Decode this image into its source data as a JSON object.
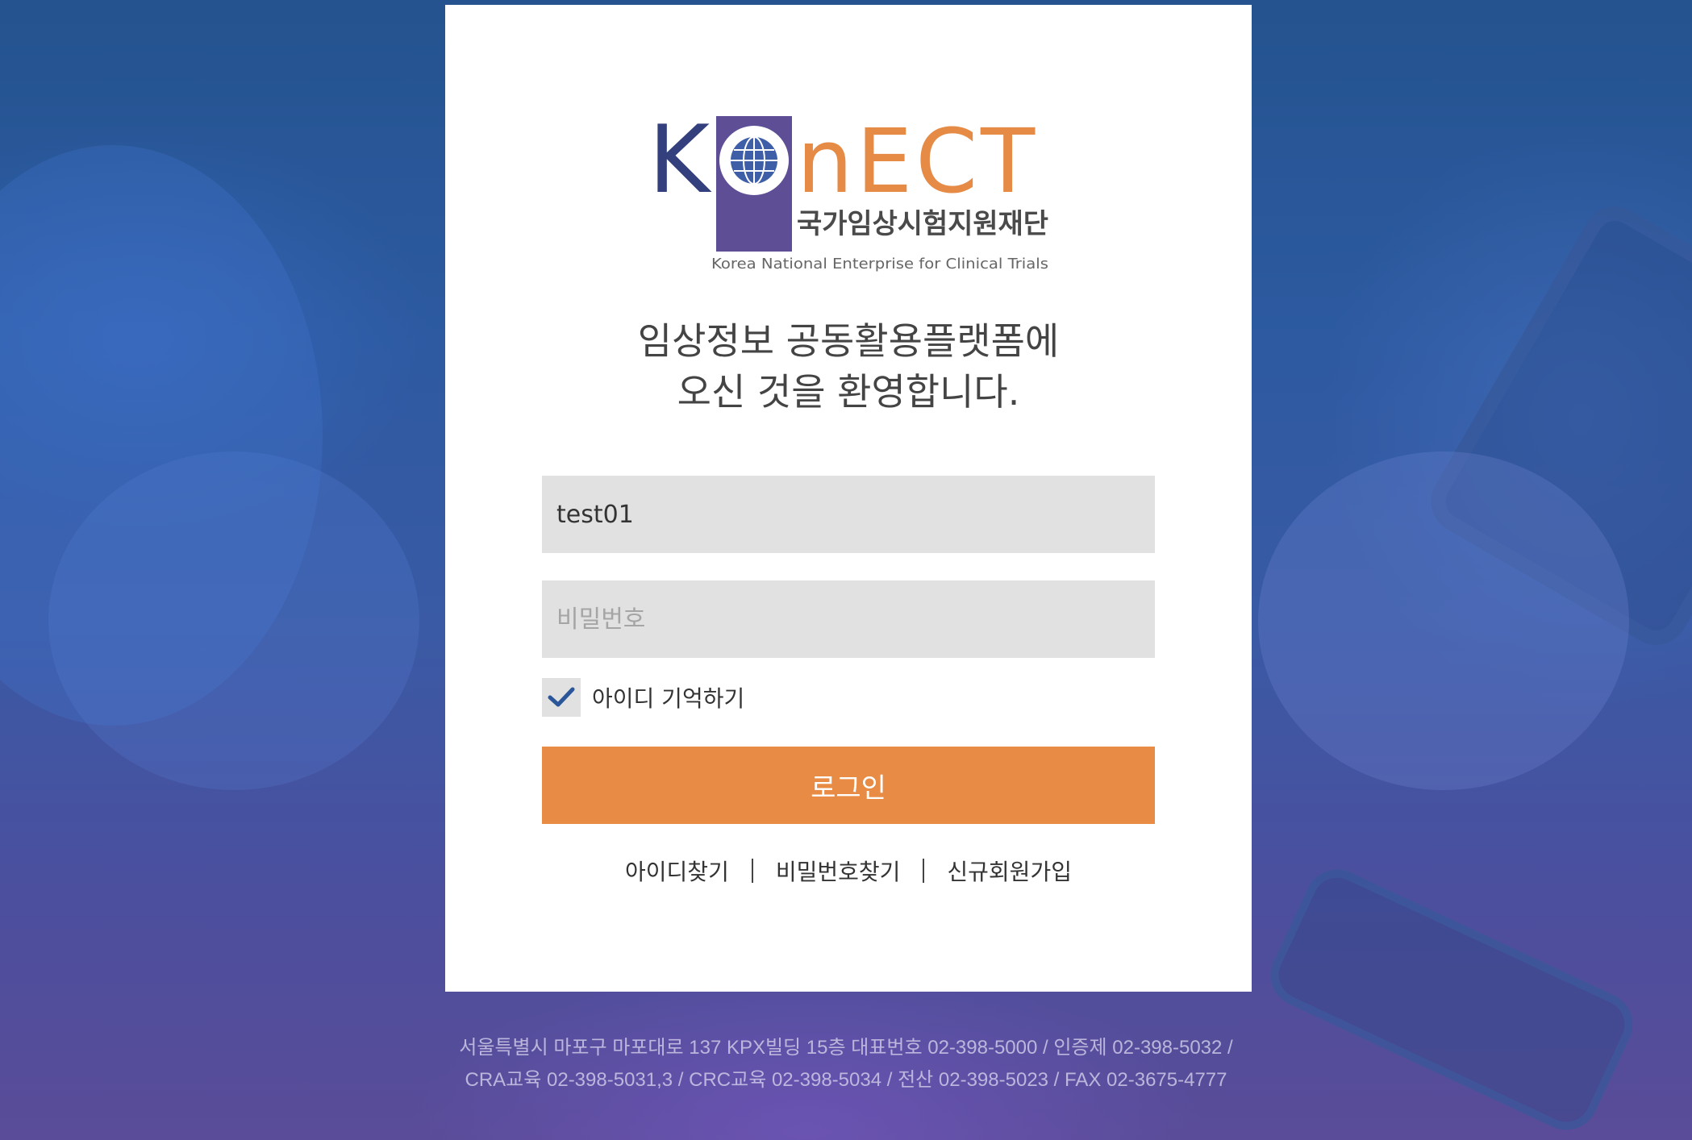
{
  "logo": {
    "letters": [
      "K",
      "n",
      "E",
      "C",
      "T"
    ],
    "org_name": "국가임상시험지원재단",
    "org_name_en": "Korea National Enterprise for Clinical Trials",
    "colors": {
      "navy": "#34407d",
      "purple": "#5d4e96",
      "orange": "#e58b46"
    }
  },
  "welcome": {
    "line1": "임상정보 공동활용플랫폼에",
    "line2": "오신 것을 환영합니다."
  },
  "form": {
    "id_value": "test01",
    "password_placeholder": "비밀번호",
    "remember_label": "아이디 기억하기",
    "remember_checked": true,
    "login_label": "로그인"
  },
  "links": {
    "find_id": "아이디찾기",
    "find_password": "비밀번호찾기",
    "signup": "신규회원가입"
  },
  "footer": {
    "line1": "서울특별시 마포구 마포대로 137 KPX빌딩 15층 대표번호 02-398-5000 / 인증제 02-398-5032 /",
    "line2": "CRA교육 02-398-5031,3 / CRC교육 02-398-5034 / 전산 02-398-5023 / FAX 02-3675-4777"
  },
  "colors": {
    "accent": "#e88b45",
    "field_bg": "#e1e1e1",
    "check": "#2b5699"
  }
}
